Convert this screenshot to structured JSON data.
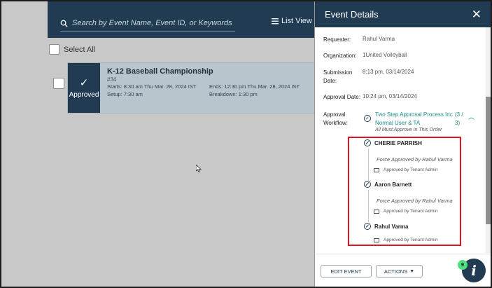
{
  "search": {
    "placeholder": "Search by Event Name, Event ID, or Keywords"
  },
  "view": {
    "label": "List View"
  },
  "select_all": "Select All",
  "event": {
    "status": "Approved",
    "title": "K-12 Baseball Championship",
    "id": "#34",
    "starts_label": "Starts:",
    "starts": "8:30 am Thu Mar. 28, 2024 IST",
    "ends_label": "Ends:",
    "ends": "12:30 pm Thu Mar. 28, 2024 IST",
    "setup_label": "Setup:",
    "setup": "7:30 am",
    "breakdown_label": "Breakdown:",
    "breakdown": "1:30 pm"
  },
  "panel": {
    "title": "Event Details",
    "requester_label": "Requester:",
    "requester": "Rahul Varma",
    "organization_label": "Organization:",
    "organization": "1United Volleyball",
    "submission_label_1": "Submission",
    "submission_label_2": "Date:",
    "submission": "8:13 pm, 03/14/2024",
    "approval_date_label": "Approval Date:",
    "approval_date": "10:24 pm, 03/14/2024",
    "workflow_label_1": "Approval",
    "workflow_label_2": "Workflow:",
    "workflow_name_1": "Two Step Approval Process Inc",
    "workflow_name_2": "Normal User & TA",
    "workflow_count_1": "(3 /",
    "workflow_count_2": "3)",
    "workflow_note": "All Must Approve In This Order",
    "approvers": [
      {
        "name": "CHERIE PARRISH",
        "note": "Force Approved by Rahul Varma",
        "by": "Approved by Tenant Admin",
        "icon": "blocked-icon"
      },
      {
        "name": "Aaron Barnett",
        "note": "Force Approved by Rahul Varma",
        "by": "Approved by Tenant Admin",
        "icon": "blocked-icon"
      },
      {
        "name": "Rahul Varma",
        "note": "",
        "by": "Approved by Tenant Admin",
        "icon": "check-circle-icon"
      }
    ],
    "edit_button": "EDIT EVENT",
    "actions_button": "ACTIONS"
  },
  "help": {
    "count": "9",
    "icon": "info-icon"
  },
  "colors": {
    "navy": "#213b52",
    "teal": "#1a8a8a",
    "highlight": "#e0141e",
    "badge": "#4fe07a"
  }
}
